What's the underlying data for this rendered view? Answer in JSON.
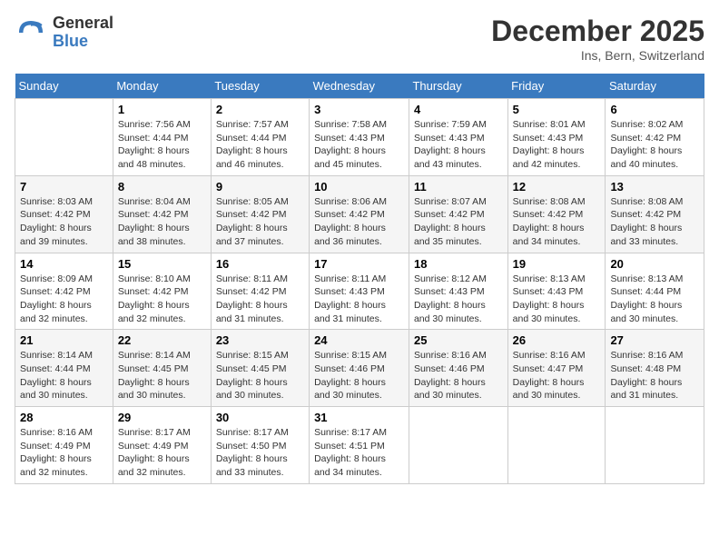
{
  "header": {
    "logo_line1": "General",
    "logo_line2": "Blue",
    "title": "December 2025",
    "subtitle": "Ins, Bern, Switzerland"
  },
  "weekdays": [
    "Sunday",
    "Monday",
    "Tuesday",
    "Wednesday",
    "Thursday",
    "Friday",
    "Saturday"
  ],
  "weeks": [
    [
      {
        "day": "",
        "sunrise": "",
        "sunset": "",
        "daylight": ""
      },
      {
        "day": "1",
        "sunrise": "7:56 AM",
        "sunset": "4:44 PM",
        "daylight": "8 hours and 48 minutes."
      },
      {
        "day": "2",
        "sunrise": "7:57 AM",
        "sunset": "4:44 PM",
        "daylight": "8 hours and 46 minutes."
      },
      {
        "day": "3",
        "sunrise": "7:58 AM",
        "sunset": "4:43 PM",
        "daylight": "8 hours and 45 minutes."
      },
      {
        "day": "4",
        "sunrise": "7:59 AM",
        "sunset": "4:43 PM",
        "daylight": "8 hours and 43 minutes."
      },
      {
        "day": "5",
        "sunrise": "8:01 AM",
        "sunset": "4:43 PM",
        "daylight": "8 hours and 42 minutes."
      },
      {
        "day": "6",
        "sunrise": "8:02 AM",
        "sunset": "4:42 PM",
        "daylight": "8 hours and 40 minutes."
      }
    ],
    [
      {
        "day": "7",
        "sunrise": "8:03 AM",
        "sunset": "4:42 PM",
        "daylight": "8 hours and 39 minutes."
      },
      {
        "day": "8",
        "sunrise": "8:04 AM",
        "sunset": "4:42 PM",
        "daylight": "8 hours and 38 minutes."
      },
      {
        "day": "9",
        "sunrise": "8:05 AM",
        "sunset": "4:42 PM",
        "daylight": "8 hours and 37 minutes."
      },
      {
        "day": "10",
        "sunrise": "8:06 AM",
        "sunset": "4:42 PM",
        "daylight": "8 hours and 36 minutes."
      },
      {
        "day": "11",
        "sunrise": "8:07 AM",
        "sunset": "4:42 PM",
        "daylight": "8 hours and 35 minutes."
      },
      {
        "day": "12",
        "sunrise": "8:08 AM",
        "sunset": "4:42 PM",
        "daylight": "8 hours and 34 minutes."
      },
      {
        "day": "13",
        "sunrise": "8:08 AM",
        "sunset": "4:42 PM",
        "daylight": "8 hours and 33 minutes."
      }
    ],
    [
      {
        "day": "14",
        "sunrise": "8:09 AM",
        "sunset": "4:42 PM",
        "daylight": "8 hours and 32 minutes."
      },
      {
        "day": "15",
        "sunrise": "8:10 AM",
        "sunset": "4:42 PM",
        "daylight": "8 hours and 32 minutes."
      },
      {
        "day": "16",
        "sunrise": "8:11 AM",
        "sunset": "4:42 PM",
        "daylight": "8 hours and 31 minutes."
      },
      {
        "day": "17",
        "sunrise": "8:11 AM",
        "sunset": "4:43 PM",
        "daylight": "8 hours and 31 minutes."
      },
      {
        "day": "18",
        "sunrise": "8:12 AM",
        "sunset": "4:43 PM",
        "daylight": "8 hours and 30 minutes."
      },
      {
        "day": "19",
        "sunrise": "8:13 AM",
        "sunset": "4:43 PM",
        "daylight": "8 hours and 30 minutes."
      },
      {
        "day": "20",
        "sunrise": "8:13 AM",
        "sunset": "4:44 PM",
        "daylight": "8 hours and 30 minutes."
      }
    ],
    [
      {
        "day": "21",
        "sunrise": "8:14 AM",
        "sunset": "4:44 PM",
        "daylight": "8 hours and 30 minutes."
      },
      {
        "day": "22",
        "sunrise": "8:14 AM",
        "sunset": "4:45 PM",
        "daylight": "8 hours and 30 minutes."
      },
      {
        "day": "23",
        "sunrise": "8:15 AM",
        "sunset": "4:45 PM",
        "daylight": "8 hours and 30 minutes."
      },
      {
        "day": "24",
        "sunrise": "8:15 AM",
        "sunset": "4:46 PM",
        "daylight": "8 hours and 30 minutes."
      },
      {
        "day": "25",
        "sunrise": "8:16 AM",
        "sunset": "4:46 PM",
        "daylight": "8 hours and 30 minutes."
      },
      {
        "day": "26",
        "sunrise": "8:16 AM",
        "sunset": "4:47 PM",
        "daylight": "8 hours and 30 minutes."
      },
      {
        "day": "27",
        "sunrise": "8:16 AM",
        "sunset": "4:48 PM",
        "daylight": "8 hours and 31 minutes."
      }
    ],
    [
      {
        "day": "28",
        "sunrise": "8:16 AM",
        "sunset": "4:49 PM",
        "daylight": "8 hours and 32 minutes."
      },
      {
        "day": "29",
        "sunrise": "8:17 AM",
        "sunset": "4:49 PM",
        "daylight": "8 hours and 32 minutes."
      },
      {
        "day": "30",
        "sunrise": "8:17 AM",
        "sunset": "4:50 PM",
        "daylight": "8 hours and 33 minutes."
      },
      {
        "day": "31",
        "sunrise": "8:17 AM",
        "sunset": "4:51 PM",
        "daylight": "8 hours and 34 minutes."
      },
      {
        "day": "",
        "sunrise": "",
        "sunset": "",
        "daylight": ""
      },
      {
        "day": "",
        "sunrise": "",
        "sunset": "",
        "daylight": ""
      },
      {
        "day": "",
        "sunrise": "",
        "sunset": "",
        "daylight": ""
      }
    ]
  ]
}
